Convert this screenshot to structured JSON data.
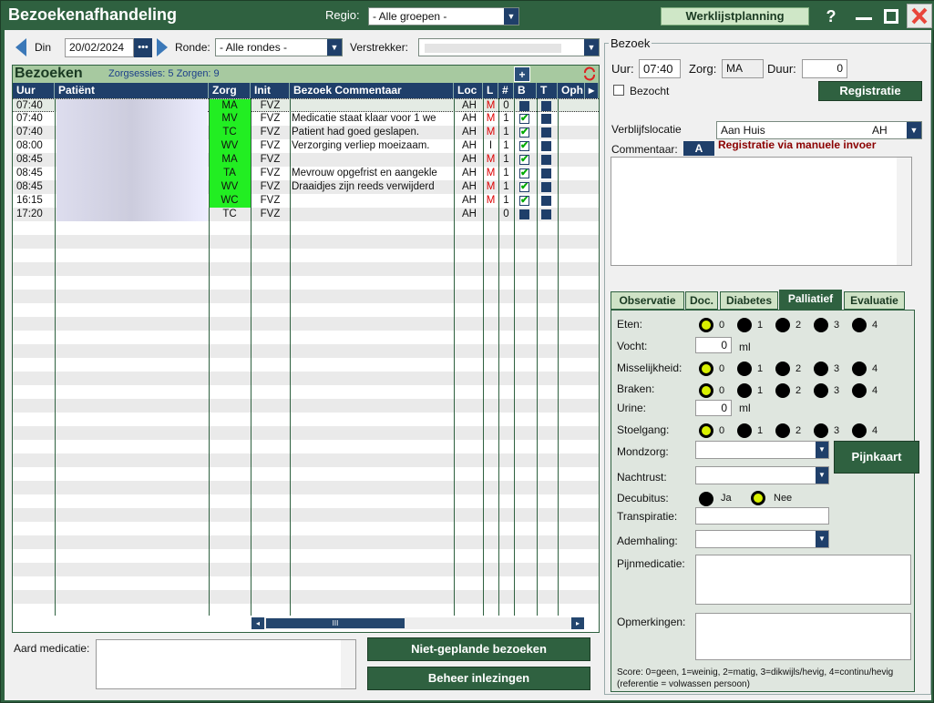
{
  "app": {
    "title": "Bezoekenafhandeling",
    "regio_label": "Regio:",
    "regio_value": "- Alle groepen -",
    "werklijst": "Werklijstplanning",
    "help": "?"
  },
  "toolbar": {
    "day": "Din",
    "date": "20/02/2024",
    "date_btn": "•••",
    "ronde_label": "Ronde:",
    "ronde_value": "- Alle rondes -",
    "verstrekker_label": "Verstrekker:"
  },
  "grid": {
    "title": "Bezoeken",
    "counts": "Zorgsessies: 5 Zorgen: 9",
    "add": "+",
    "columns": [
      "Uur",
      "Patiënt",
      "Zorg",
      "Init",
      "Bezoek Commentaar",
      "Loc",
      "L",
      "#",
      "B",
      "T",
      "Oph",
      "▸"
    ],
    "rows": [
      {
        "uur": "07:40",
        "zorg": "MA",
        "init": "FVZ",
        "comment": "",
        "loc": "AH",
        "l": "M",
        "n": "0",
        "b": false,
        "t": true,
        "green": true,
        "sel": true
      },
      {
        "uur": "07:40",
        "zorg": "MV",
        "init": "FVZ",
        "comment": "Medicatie staat klaar voor 1 we",
        "loc": "AH",
        "l": "M",
        "n": "1",
        "b": true,
        "t": true,
        "green": true
      },
      {
        "uur": "07:40",
        "zorg": "TC",
        "init": "FVZ",
        "comment": "Patient had goed geslapen.",
        "loc": "AH",
        "l": "M",
        "n": "1",
        "b": true,
        "t": true,
        "green": true
      },
      {
        "uur": "08:00",
        "zorg": "WV",
        "init": "FVZ",
        "comment": "Verzorging verliep moeizaam.",
        "loc": "AH",
        "l": "I",
        "n": "1",
        "b": true,
        "t": true,
        "green": true
      },
      {
        "uur": "08:45",
        "zorg": "MA",
        "init": "FVZ",
        "comment": "",
        "loc": "AH",
        "l": "M",
        "n": "1",
        "b": true,
        "t": true,
        "green": true
      },
      {
        "uur": "08:45",
        "zorg": "TA",
        "init": "FVZ",
        "comment": "Mevrouw opgefrist en aangekle",
        "loc": "AH",
        "l": "M",
        "n": "1",
        "b": true,
        "t": true,
        "green": true
      },
      {
        "uur": "08:45",
        "zorg": "WV",
        "init": "FVZ",
        "comment": "Draaidjes zijn reeds verwijderd",
        "loc": "AH",
        "l": "M",
        "n": "1",
        "b": true,
        "t": true,
        "green": true
      },
      {
        "uur": "16:15",
        "zorg": "WC",
        "init": "FVZ",
        "comment": "",
        "loc": "AH",
        "l": "M",
        "n": "1",
        "b": true,
        "t": true,
        "green": true
      },
      {
        "uur": "17:20",
        "zorg": "TC",
        "init": "FVZ",
        "comment": "",
        "loc": "AH",
        "l": "",
        "n": "0",
        "b": false,
        "t": true,
        "green": false
      }
    ],
    "scroll_thumb": "III"
  },
  "bottom": {
    "aard_label": "Aard medicatie:",
    "btn1": "Niet-geplande bezoeken",
    "btn2": "Beheer inlezingen"
  },
  "bezoek": {
    "title": "Bezoek",
    "uur_label": "Uur:",
    "uur": "07:40",
    "zorg_label": "Zorg:",
    "zorg": "MA",
    "duur_label": "Duur:",
    "duur": "0",
    "bezocht": "Bezocht",
    "registratie": "Registratie",
    "verblijf_label": "Verblijfslocatie",
    "verblijf_value": "Aan Huis",
    "verblijf_code": "AH",
    "comment_label": "Commentaar:",
    "comment_btn": "A",
    "manual_note": "Registratie via manuele invoer"
  },
  "tabs": [
    "Observatie",
    "Doc.",
    "Diabetes",
    "Palliatief",
    "Evaluatie"
  ],
  "palliatief": {
    "eten": "Eten:",
    "vocht": "Vocht:",
    "vocht_val": "0",
    "ml": "ml",
    "misselijkheid": "Misselijkheid:",
    "braken": "Braken:",
    "urine": "Urine:",
    "urine_val": "0",
    "stoelgang": "Stoelgang:",
    "scale": [
      "0",
      "1",
      "2",
      "3",
      "4"
    ],
    "mondzorg": "Mondzorg:",
    "nachtrust": "Nachtrust:",
    "pijnkaart": "Pijnkaart",
    "decubitus": "Decubitus:",
    "ja": "Ja",
    "nee": "Nee",
    "transpiratie": "Transpiratie:",
    "ademhaling": "Ademhaling:",
    "pijnmedicatie": "Pijnmedicatie:",
    "opmerkingen": "Opmerkingen:",
    "score_note1": "Score: 0=geen, 1=weinig, 2=matig, 3=dikwijls/hevig, 4=continu/hevig",
    "score_note2": "(referentie = volwassen persoon)"
  },
  "colors": {
    "accent": "#2f6140",
    "header": "#1f3f6a",
    "green_cell": "#22ee22",
    "red_text": "#8b0000"
  }
}
